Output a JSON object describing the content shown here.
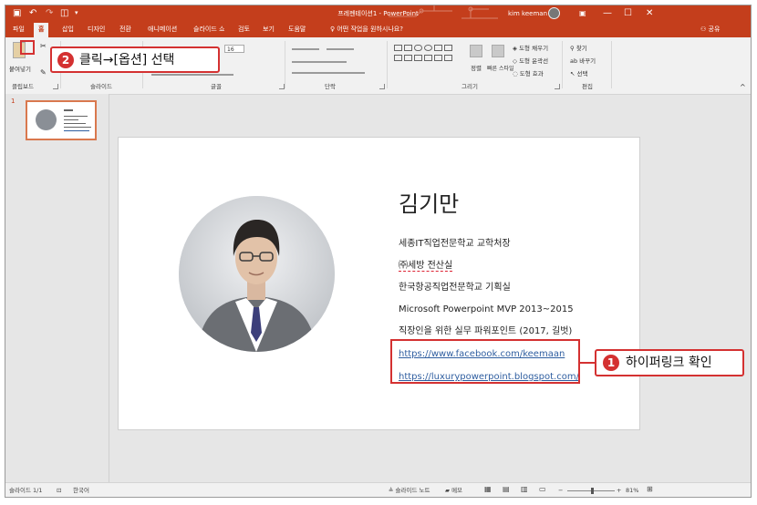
{
  "window": {
    "title": "프레젠테이션1 - PowerPoint",
    "user": "kim keeman"
  },
  "tabs": [
    "파일",
    "홈",
    "삽입",
    "디자인",
    "전환",
    "애니메이션",
    "슬라이드 쇼",
    "검토",
    "보기",
    "도움말"
  ],
  "search_placeholder": "어떤 작업을 원하시나요?",
  "share_label": "공유",
  "ribbon": {
    "groups": [
      "클립보드",
      "슬라이드",
      "글꼴",
      "단락",
      "그리기",
      "편집"
    ],
    "paste_label": "붙여넣기",
    "arrange_label": "정렬",
    "quick_styles_label": "빠른 스타일",
    "fill_label": "도형 채우기",
    "outline_label": "도형 윤곽선",
    "effects_label": "도형 효과",
    "find_label": "찾기",
    "replace_label": "바꾸기",
    "select_label": "선택"
  },
  "slide_pane": {
    "slide_number": "1"
  },
  "slide": {
    "name": "김기만",
    "lines": [
      "세종IT직업전문학교 교학처장",
      "㈜세방 전산실",
      "한국항공직업전문학교 기획실",
      "Microsoft Powerpoint MVP 2013~2015",
      "직장인을 위한 실무 파워포인트 (2017, 길벗)"
    ],
    "links": [
      "https://www.facebook.com/keemaan",
      "https://luxurypowerpoint.blogspot.com/"
    ]
  },
  "status": {
    "slide_info": "슬라이드 1/1",
    "language": "한국어",
    "notes": "슬라이드 노트",
    "comments": "메모",
    "zoom": "81%"
  },
  "annotations": {
    "step1_num": "1",
    "step1_text": "하이퍼링크 확인",
    "step2_num": "2",
    "step2_text": "클릭→[옵션] 선택"
  },
  "colors": {
    "accent": "#c43e1c",
    "callout": "#d43131",
    "link": "#2f5ea0"
  }
}
